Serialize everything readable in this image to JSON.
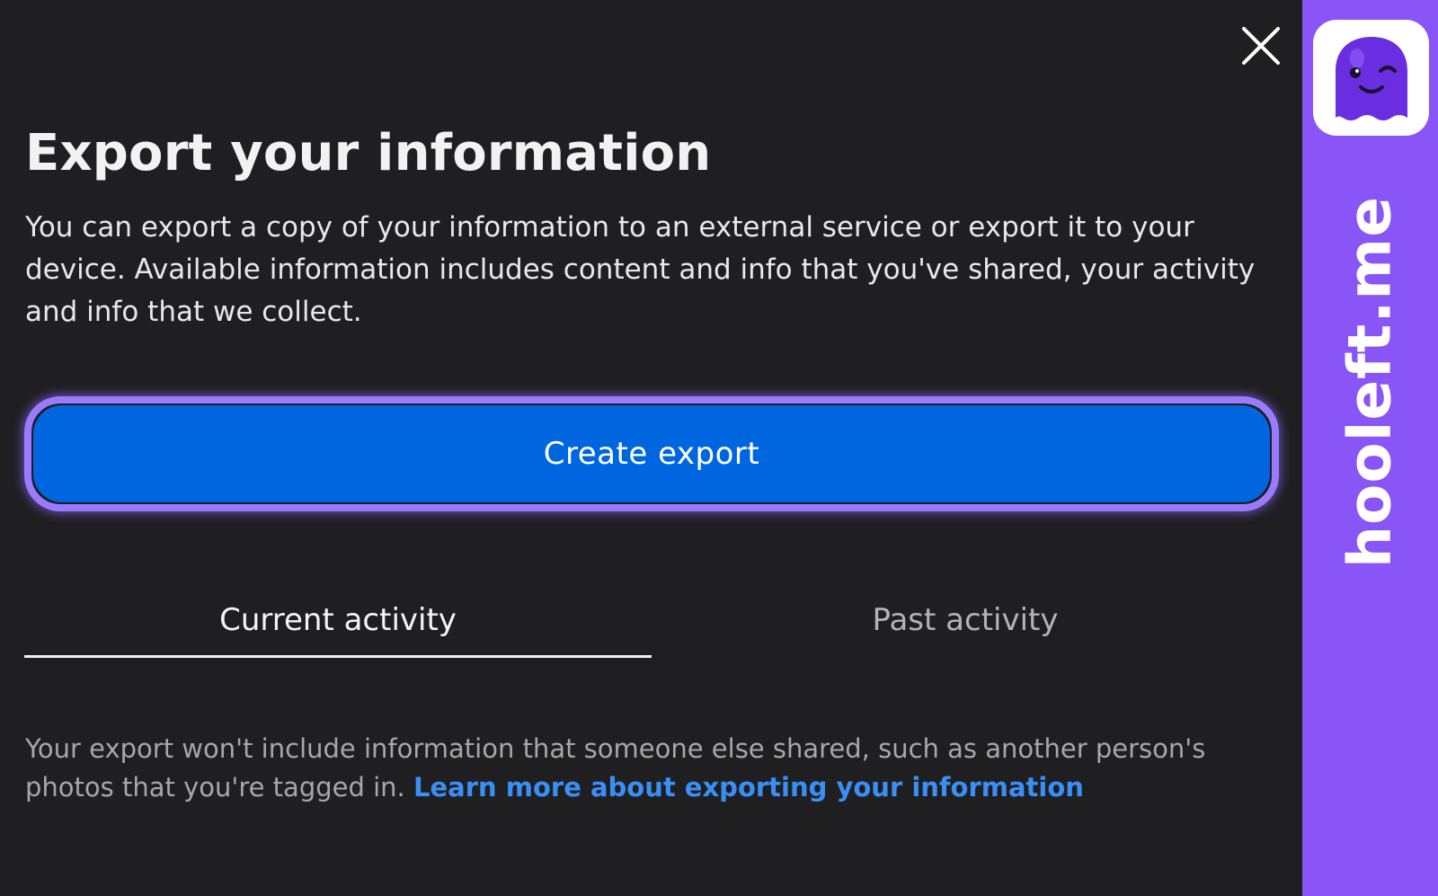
{
  "dialog": {
    "title": "Export your information",
    "description": "You can export a copy of your information to an external service or export it to your device. Available information includes content and info that you've shared, your activity and info that we collect.",
    "create_export_label": "Create export",
    "tabs": [
      {
        "label": "Current activity",
        "active": true
      },
      {
        "label": "Past activity",
        "active": false
      }
    ],
    "footnote_text": "Your export won't include information that someone else shared, such as another person's photos that you're tagged in. ",
    "footnote_link": "Learn more about exporting your information",
    "close_icon": "close-icon"
  },
  "watermark": {
    "text": "hooleft.me",
    "logo_icon": "ghost-logo-icon"
  },
  "colors": {
    "background": "#1f1f22",
    "button": "#0066e0",
    "focus_ring": "#9a7bff",
    "link": "#3a8ff5",
    "brand": "#8a55f7"
  }
}
